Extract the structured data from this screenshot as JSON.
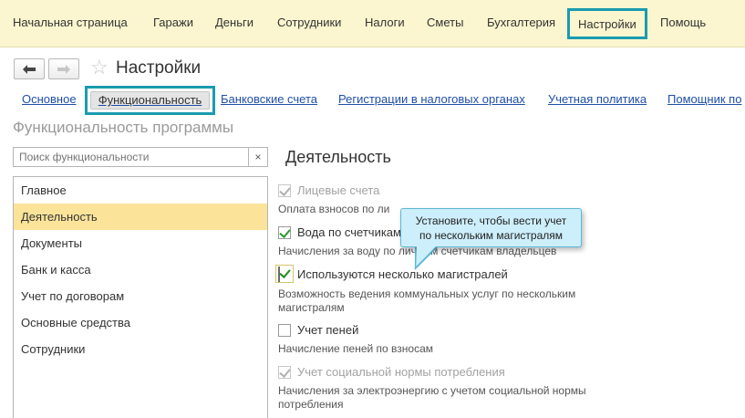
{
  "menu": {
    "items": [
      "Начальная страница",
      "Гаражи",
      "Деньги",
      "Сотрудники",
      "Налоги",
      "Сметы",
      "Бухгалтерия",
      "Настройки",
      "Помощь"
    ],
    "active_index": 7
  },
  "titlebar": {
    "back_icon": "arrow-left",
    "forward_icon": "arrow-right",
    "favorite_icon": "star",
    "title": "Настройки"
  },
  "tabs": {
    "items": [
      "Основное",
      "Функциональность",
      "Банковские счета",
      "Регистрации в налоговых органах",
      "Учетная политика",
      "Помощник по"
    ],
    "active_index": 1
  },
  "section_title": "Функциональность программы",
  "search": {
    "placeholder": "Поиск функциональности",
    "clear_label": "×"
  },
  "list": {
    "items": [
      "Главное",
      "Деятельность",
      "Документы",
      "Банк и касса",
      "Учет по договорам",
      "Основные средства",
      "Сотрудники"
    ],
    "selected_index": 1
  },
  "content": {
    "title": "Деятельность",
    "options": [
      {
        "label": "Лицевые счета",
        "checked": true,
        "disabled": true,
        "description": "Оплата взносов по ли"
      },
      {
        "label": "Вода по счетчикам",
        "checked": true,
        "disabled": false,
        "description": "Начисления за воду по личным счетчикам владельцев"
      },
      {
        "label": "Используются несколько магистралей",
        "checked": true,
        "disabled": false,
        "highlighted": true,
        "description_line1": "Возможность ведения коммунальных услуг по нескольким",
        "description_line2": "магистралям"
      },
      {
        "label": "Учет пеней",
        "checked": false,
        "disabled": false,
        "description": "Начисление пеней по взносам"
      },
      {
        "label": "Учет социальной нормы потребления",
        "checked": true,
        "disabled": true,
        "description_line1": "Начисления за электроэнергию с учетом социальной нормы",
        "description_line2": "потребления"
      }
    ]
  },
  "tooltip": {
    "line1": "Установите, чтобы вести учет",
    "line2": "по нескольким магистралям"
  },
  "colors": {
    "menu_bg": "#fbf6cf",
    "highlight_border": "#1a9bb0",
    "selected_row": "#fbe49a",
    "link": "#1f4fa8",
    "tooltip_bg": "#cdeefb"
  }
}
